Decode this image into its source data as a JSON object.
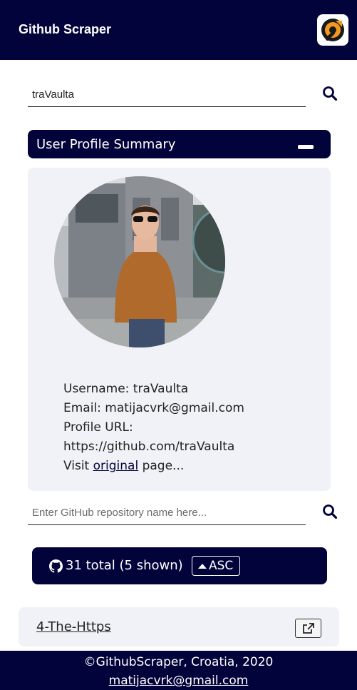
{
  "header": {
    "title": "Github Scraper",
    "logo_icon": "wrench-gear-logo-icon"
  },
  "user_search": {
    "value": "traVaulta",
    "icon": "search-icon"
  },
  "profile_section": {
    "title": "User Profile Summary",
    "collapse_icon": "minus-icon",
    "avatar_alt": "profile photo",
    "username_line": "Username: traVaulta",
    "email_line": "Email: matijacvrk@gmail.com",
    "profile_url_label": "Profile URL:",
    "profile_url": "https://github.com/traVaulta",
    "visit_prefix": "Visit",
    "visit_link": "original",
    "visit_suffix": "page..."
  },
  "repo_search": {
    "value": "",
    "placeholder": "Enter GitHub repository name here...",
    "icon": "search-icon"
  },
  "stats": {
    "icon": "github-icon",
    "text": "31 total (5 shown)",
    "sort_label": "ASC",
    "sort_icon": "caret-up-icon"
  },
  "repos": [
    {
      "name": "4-The-Https",
      "open_icon": "external-link-icon"
    }
  ],
  "footer": {
    "copyright": "©GithubScraper, Croatia, 2020",
    "email": "matijacvrk@gmail.com"
  },
  "colors": {
    "primary": "#03033b",
    "card_bg": "#f1f2f7",
    "accent_orange": "#f39a1e"
  }
}
